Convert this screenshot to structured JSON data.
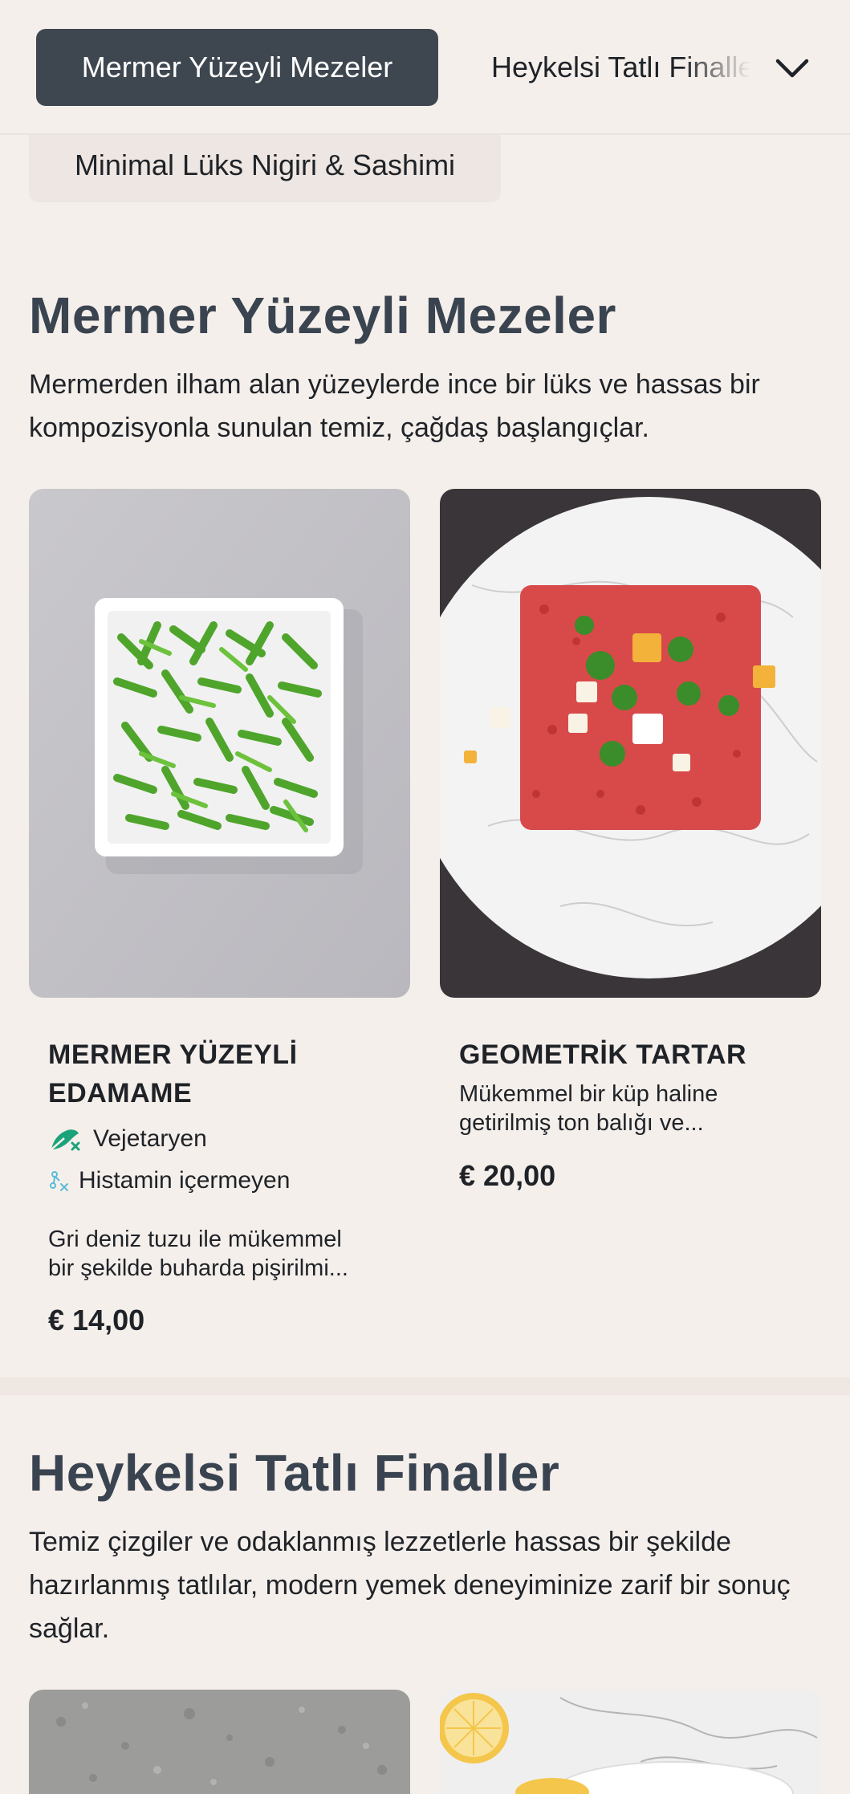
{
  "nav": {
    "active_tab": "Mermer Yüzeyli Mezeler",
    "next_tab": "Heykelsi Tatlı Finaller",
    "wrapped_tab": "Minimal Lüks Nigiri & Sashimi",
    "chevron_icon": "chevron-down-icon"
  },
  "sections": [
    {
      "title": "Mermer Yüzeyli Mezeler",
      "description": "Mermerden ilham alan yüzeylerde ince bir lüks ve hassas bir kompozisyonla sunulan temiz, çağdaş başlangıçlar.",
      "items": [
        {
          "title_line1": "MERMER YÜZEYLİ",
          "title_line2": "EDAMAME",
          "tags": [
            {
              "label": "Vejetaryen",
              "icon": "vegetarian-icon",
              "color": "#1aa37a"
            },
            {
              "label": "Histamin içermeyen",
              "icon": "histamine-free-icon",
              "color": "#5bbcd6"
            }
          ],
          "desc_line1": "Gri deniz tuzu ile mükemmel",
          "desc_line2": "bir şekilde buharda pişirilmi...",
          "price": "€ 14,00"
        },
        {
          "title": "GEOMETRİK TARTAR",
          "desc_line1": "Mükemmel bir küp haline",
          "desc_line2": "getirilmiş ton balığı ve...",
          "price": "€ 20,00"
        }
      ]
    },
    {
      "title": "Heykelsi Tatlı Finaller",
      "description": "Temiz çizgiler ve odaklanmış lezzetlerle hassas bir şekilde hazırlanmış tatlılar, modern yemek deneyiminize zarif bir sonuç sağlar."
    }
  ],
  "colors": {
    "background": "#f5efeb",
    "active_tab": "#3e4750",
    "heading": "#3a4450"
  }
}
